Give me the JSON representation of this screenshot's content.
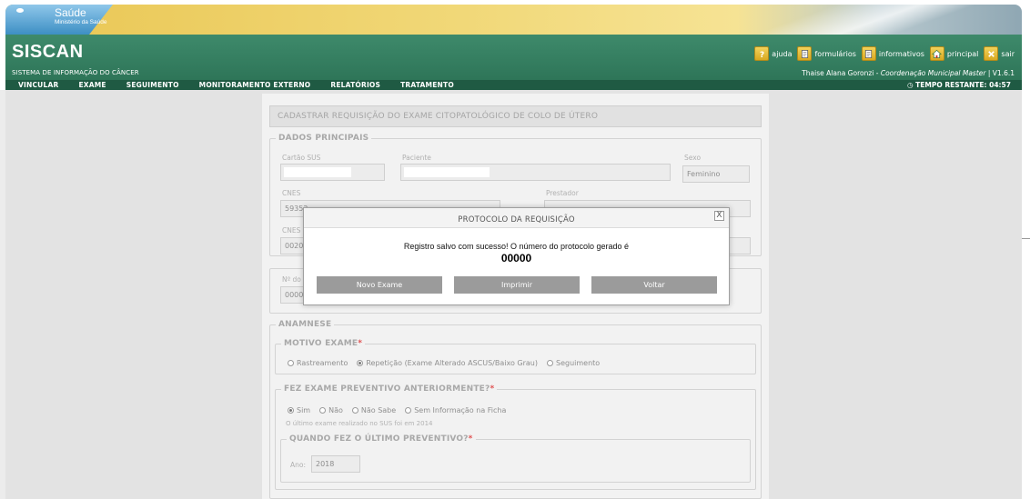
{
  "banner": {
    "brand": "Saúde",
    "ministry": "Ministério da Saúde",
    "corner_mark": "-"
  },
  "header": {
    "title": "SISCAN",
    "subtitle": "SISTEMA DE INFORMAÇÃO DO CÂNCER",
    "links": [
      {
        "label": "ajuda",
        "icon": "help-icon"
      },
      {
        "label": "formulários",
        "icon": "document-icon"
      },
      {
        "label": "informativos",
        "icon": "document-icon"
      },
      {
        "label": "principal",
        "icon": "home-icon"
      },
      {
        "label": "sair",
        "icon": "close-icon"
      }
    ],
    "user_name": "Thaise Alana Goronzi",
    "user_separator": " - ",
    "user_role": "Coordenação Municipal Master",
    "version": " | V1.6.1"
  },
  "nav": {
    "items": [
      "VINCULAR",
      "EXAME",
      "SEGUIMENTO",
      "MONITORAMENTO EXTERNO",
      "RELATÓRIOS",
      "TRATAMENTO"
    ],
    "timer_label": "TEMPO RESTANTE: 04:57"
  },
  "form": {
    "title": "CADASTRAR REQUISIÇÃO DO EXAME CITOPATOLÓGICO DE COLO DE ÚTERO",
    "dados_principais": {
      "legend": "DADOS PRINCIPAIS",
      "cartao_sus_label": "Cartão SUS",
      "paciente_label": "Paciente",
      "sexo_label": "Sexo",
      "sexo_value": "Feminino",
      "cnes_label": "CNES",
      "cnes_value": "59352...",
      "prestador_label": "Prestador",
      "prestador_value": "...",
      "cnes2_label": "CNES",
      "cnes2_value": "0020..."
    },
    "protocolo": {
      "label": "Nº do",
      "value": "0000"
    },
    "anamnese": {
      "legend": "ANAMNESE",
      "motivo_legend": "MOTIVO EXAME",
      "motivo_options": [
        "Rastreamento",
        "Repetição (Exame Alterado ASCUS/Baixo Grau)",
        "Seguimento"
      ],
      "preventivo_legend": "FEZ EXAME PREVENTIVO ANTERIORMENTE?",
      "preventivo_options": [
        "Sim",
        "Não",
        "Não Sabe",
        "Sem Informação na Ficha"
      ],
      "preventivo_hint": "O último exame realizado no SUS foi em 2014",
      "ultimo_legend": "QUANDO FEZ O ÚLTIMO PREVENTIVO?",
      "ano_label": "Ano:",
      "ano_value": "2018",
      "required_mark": "*"
    }
  },
  "modal": {
    "title": "PROTOCOLO DA REQUISIÇÃO",
    "close_label": "X",
    "message": "Registro salvo com sucesso! O número do protocolo gerado é",
    "protocol_number": "00000",
    "buttons": {
      "novo_exame": "Novo Exame",
      "imprimir": "Imprimir",
      "voltar": "Voltar"
    }
  },
  "colors": {
    "header_green": "#2e7558",
    "nav_green": "#1f5a43",
    "banner_yellow": "#f1d878",
    "modal_button": "#9b9b9b"
  }
}
